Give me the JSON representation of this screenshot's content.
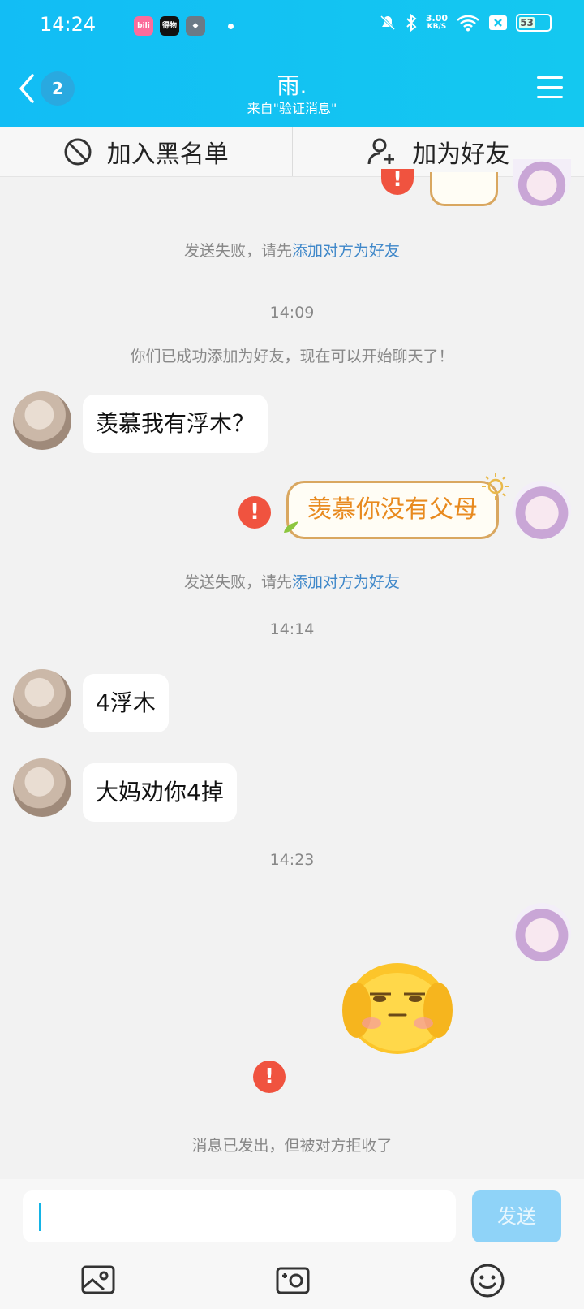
{
  "status_bar": {
    "time": "14:24",
    "apps": [
      "bilibili",
      "得物",
      "app"
    ],
    "speed_value": "3.00",
    "speed_unit": "KB/S",
    "battery": "53"
  },
  "header": {
    "back_badge": "2",
    "title": "雨.",
    "subtitle": "来自\"验证消息\""
  },
  "actions": {
    "blacklist": "加入黑名单",
    "add_friend": "加为好友"
  },
  "messages": {
    "fail_prefix_1": "发送失败，请先",
    "fail_link_1": "添加对方为好友",
    "time_1": "14:09",
    "friend_added": "你们已成功添加为好友，现在可以开始聊天了！",
    "her_1": "羡慕我有浮木？",
    "me_1": "羡慕你没有父母",
    "fail_prefix_2": "发送失败，请先",
    "fail_link_2": "添加对方为好友",
    "time_2": "14:14",
    "her_2": "4浮木",
    "her_3": "大妈劝你4掉",
    "time_3": "14:23",
    "rejected": "消息已发出，但被对方拒收了"
  },
  "input": {
    "placeholder": "",
    "send_label": "发送"
  },
  "colors": {
    "header": "#14c8f0",
    "link": "#3e87c9",
    "error": "#f0533f",
    "send_disabled": "#8fd3f8"
  }
}
